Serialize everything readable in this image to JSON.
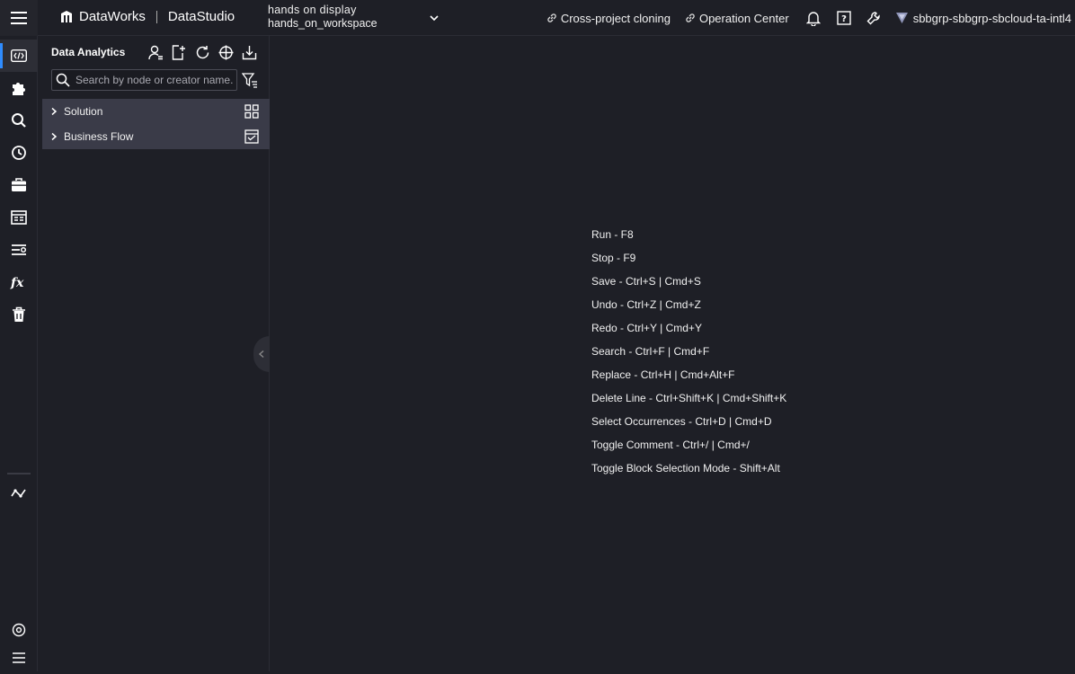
{
  "header": {
    "brand_name": "DataWorks",
    "module_name": "DataStudio",
    "workspace_display": "hands on display",
    "workspace_id": "hands_on_workspace",
    "links": [
      {
        "label": "Cross-project cloning"
      },
      {
        "label": "Operation Center"
      }
    ],
    "account": "sbbgrp-sbbgrp-sbcloud-ta-intl4"
  },
  "rail": {
    "items": [
      {
        "name": "data-development-icon",
        "active": true
      },
      {
        "name": "puzzle-icon"
      },
      {
        "name": "search-icon"
      },
      {
        "name": "history-icon"
      },
      {
        "name": "briefcase-icon"
      },
      {
        "name": "table-icon"
      },
      {
        "name": "list-settings-icon"
      },
      {
        "name": "function-icon"
      },
      {
        "name": "recycle-bin-icon"
      },
      {
        "name": "lineage-icon"
      },
      {
        "name": "settings-icon"
      },
      {
        "name": "more-menu-icon"
      }
    ]
  },
  "panel": {
    "title": "Data Analytics",
    "search_placeholder": "Search by node or creator name.",
    "tree": [
      {
        "label": "Solution",
        "icon": "grid-icon"
      },
      {
        "label": "Business Flow",
        "icon": "flow-check-icon"
      }
    ]
  },
  "shortcuts": [
    "Run - F8",
    "Stop - F9",
    "Save - Ctrl+S | Cmd+S",
    "Undo - Ctrl+Z | Cmd+Z",
    "Redo - Ctrl+Y | Cmd+Y",
    "Search - Ctrl+F | Cmd+F",
    "Replace - Ctrl+H | Cmd+Alt+F",
    "Delete Line - Ctrl+Shift+K | Cmd+Shift+K",
    "Select Occurrences - Ctrl+D | Cmd+D",
    "Toggle Comment - Ctrl+/ | Cmd+/",
    "Toggle Block Selection Mode - Shift+Alt"
  ],
  "colors": {
    "background": "#1e1f26",
    "accent": "#2f8cff",
    "tree_bg": "#3a3b48"
  }
}
